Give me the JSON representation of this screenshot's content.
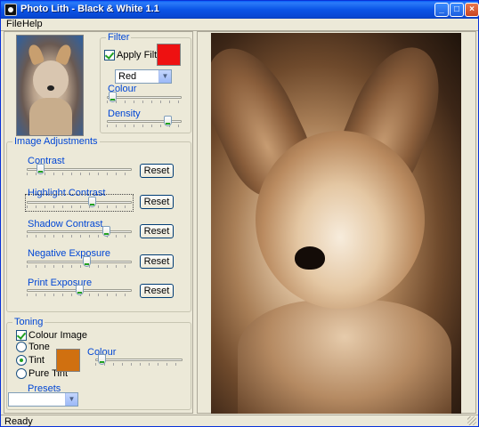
{
  "window": {
    "title": "Photo Lith - Black & White 1.1"
  },
  "menu": {
    "file": "File",
    "help": "Help"
  },
  "filter": {
    "legend": "Filter",
    "apply_label": "Apply Filter",
    "apply_checked": true,
    "color_swatch": "#ee1111",
    "select_value": "Red",
    "colour_label": "Colour",
    "colour_level": 0.02,
    "density_label": "Density",
    "density_level": 0.85
  },
  "adjustments": {
    "legend": "Image Adjustments",
    "items": [
      {
        "label": "Contrast",
        "reset": "Reset",
        "level": 0.1
      },
      {
        "label": "Highlight Contrast",
        "reset": "Reset",
        "level": 0.63
      },
      {
        "label": "Shadow Contrast",
        "reset": "Reset",
        "level": 0.78
      },
      {
        "label": "Negative Exposure",
        "reset": "Reset",
        "level": 0.58
      },
      {
        "label": "Print Exposure",
        "reset": "Reset",
        "level": 0.5
      }
    ]
  },
  "toning": {
    "legend": "Toning",
    "colour_image_label": "Colour Image",
    "colour_image_checked": true,
    "options": [
      "Tone",
      "Tint",
      "Pure Tint"
    ],
    "selected_option": "Tint",
    "swatch_color": "#d07010",
    "colour_label": "Colour",
    "colour_level": 0.03,
    "presets_label": "Presets",
    "presets_value": ""
  },
  "status": {
    "text": "Ready"
  },
  "colors": {
    "accent_blue": "#0046d5",
    "photo_tone": "#a97f57"
  }
}
